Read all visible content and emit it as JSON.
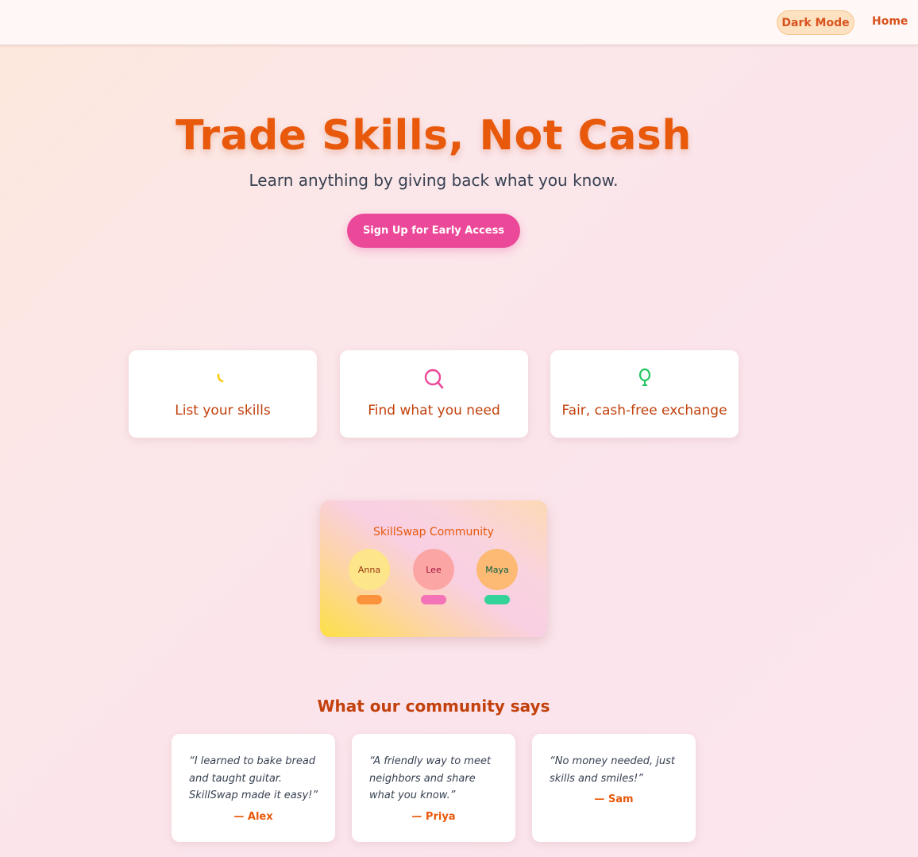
{
  "nav": {
    "dark_mode_label": "Dark Mode",
    "home_label": "Home"
  },
  "hero": {
    "title": "Trade Skills, Not Cash",
    "subtitle": "Learn anything by giving back what you know.",
    "cta_label": "Sign Up for Early Access"
  },
  "features": [
    {
      "label": "List your skills",
      "icon": "spinner-icon",
      "color": "#facc15"
    },
    {
      "label": "Find what you need",
      "icon": "search-icon",
      "color": "#ec4899"
    },
    {
      "label": "Fair, cash-free exchange",
      "icon": "balloon-icon",
      "color": "#22c55e"
    }
  ],
  "community": {
    "title": "SkillSwap Community",
    "members": [
      {
        "name": "Anna",
        "avatar_color": "#fde68a",
        "text_color": "#9a3412",
        "pill_color": "#fb923c"
      },
      {
        "name": "Lee",
        "avatar_color": "#fca5a5",
        "text_color": "#9f1239",
        "pill_color": "#f472b6"
      },
      {
        "name": "Maya",
        "avatar_color": "#fdba74",
        "text_color": "#065f46",
        "pill_color": "#34d399"
      }
    ]
  },
  "testimonials": {
    "heading": "What our community says",
    "items": [
      {
        "quote": "“I learned to bake bread and taught guitar. SkillSwap made it easy!”",
        "author": "— Alex"
      },
      {
        "quote": "“A friendly way to meet neighbors and share what you know.”",
        "author": "— Priya"
      },
      {
        "quote": "“No money needed, just skills and smiles!”",
        "author": "— Sam"
      }
    ]
  }
}
